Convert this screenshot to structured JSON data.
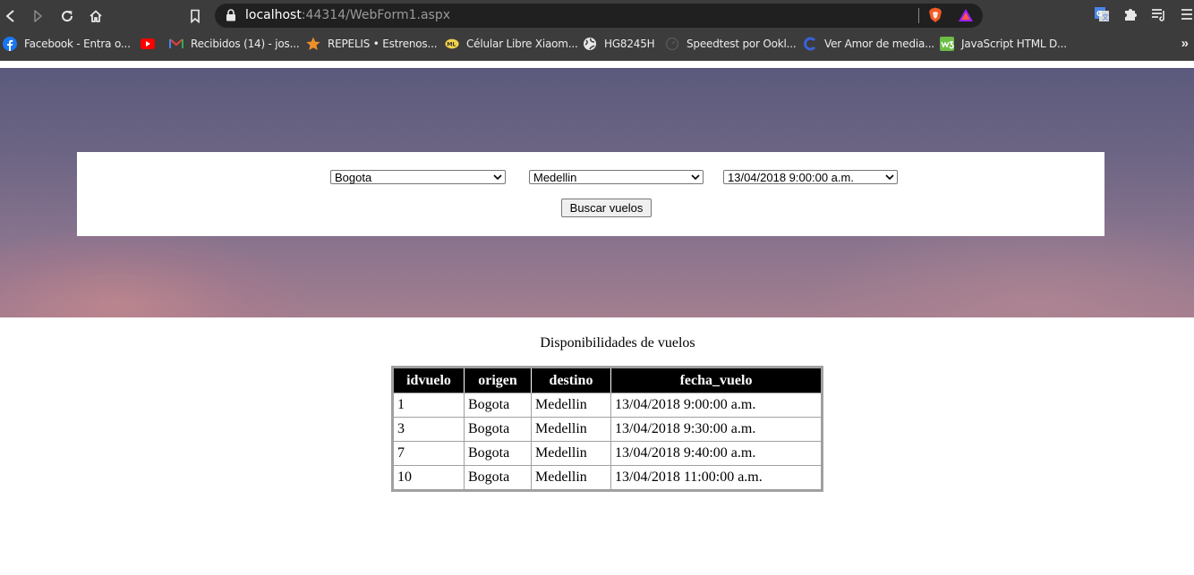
{
  "browser": {
    "url_host": "localhost",
    "url_rest": ":44314/WebForm1.aspx",
    "bookmarks": [
      {
        "label": "Facebook - Entra o...",
        "icon": "facebook-icon"
      },
      {
        "label": "",
        "icon": "youtube-icon"
      },
      {
        "label": "Recibidos (14) - jos...",
        "icon": "gmail-icon"
      },
      {
        "label": "REPELIS • Estrenos...",
        "icon": "star-icon"
      },
      {
        "label": "Célular Libre Xiaom...",
        "icon": "store-icon"
      },
      {
        "label": "HG8245H",
        "icon": "globe-icon"
      },
      {
        "label": "Speedtest por Ookl...",
        "icon": "speedtest-icon"
      },
      {
        "label": "Ver Amor de media...",
        "icon": "c-logo-icon"
      },
      {
        "label": "JavaScript HTML D...",
        "icon": "w3-icon"
      }
    ],
    "more": "»",
    "colors": {
      "chrome": "#3c3c3c",
      "urlbar": "#202020"
    }
  },
  "search": {
    "origin": "Bogota",
    "destination": "Medellin",
    "date": "13/04/2018 9:00:00 a.m.",
    "button": "Buscar vuelos"
  },
  "results": {
    "title": "Disponibilidades de vuelos",
    "columns": [
      "idvuelo",
      "origen",
      "destino",
      "fecha_vuelo"
    ],
    "rows": [
      [
        "1",
        "Bogota",
        "Medellin",
        "13/04/2018 9:00:00 a.m."
      ],
      [
        "3",
        "Bogota",
        "Medellin",
        "13/04/2018 9:30:00 a.m."
      ],
      [
        "7",
        "Bogota",
        "Medellin",
        "13/04/2018 9:40:00 a.m."
      ],
      [
        "10",
        "Bogota",
        "Medellin",
        "13/04/2018 11:00:00 a.m."
      ]
    ]
  }
}
